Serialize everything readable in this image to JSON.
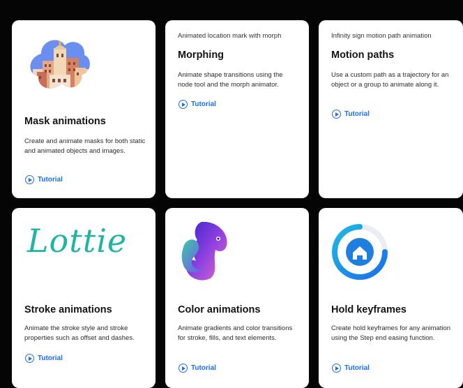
{
  "cards": [
    {
      "id": "mask",
      "eyebrow": "",
      "title": "Mask animations",
      "description": "Create and animate masks for both static and animated objects and images.",
      "link": "Tutorial",
      "illustration_icon": "city-cloud-illustration"
    },
    {
      "id": "morph",
      "eyebrow": "Animated location mark with morph",
      "title": "Morphing",
      "description": "Animate shape transitions using the node tool and the morph animator.",
      "link": "Tutorial"
    },
    {
      "id": "motion",
      "eyebrow": "Infinity sign motion path animation",
      "title": "Motion paths",
      "description": "Use a custom path as a trajectory for an object or a group to animate along it.",
      "link": "Tutorial"
    },
    {
      "id": "stroke",
      "eyebrow": "",
      "title": "Stroke animations",
      "description": "Animate the stroke style and stroke properties such as offset and dashes.",
      "link": "Tutorial",
      "logo_text": "Lottie"
    },
    {
      "id": "color",
      "eyebrow": "",
      "title": "Color animations",
      "description": "Animate gradients and color transitions for stroke, fills, and text elements.",
      "link": "Tutorial",
      "illustration_icon": "chameleon-icon"
    },
    {
      "id": "hold",
      "eyebrow": "",
      "title": "Hold keyframes",
      "description": "Create hold keyframes for any animation using the Step end easing function.",
      "link": "Tutorial",
      "illustration_icon": "home-progress-icon"
    }
  ],
  "colors": {
    "background": "#050505",
    "card": "#ffffff",
    "link": "#1a6fe8",
    "lottie": "#1fb5a5"
  }
}
